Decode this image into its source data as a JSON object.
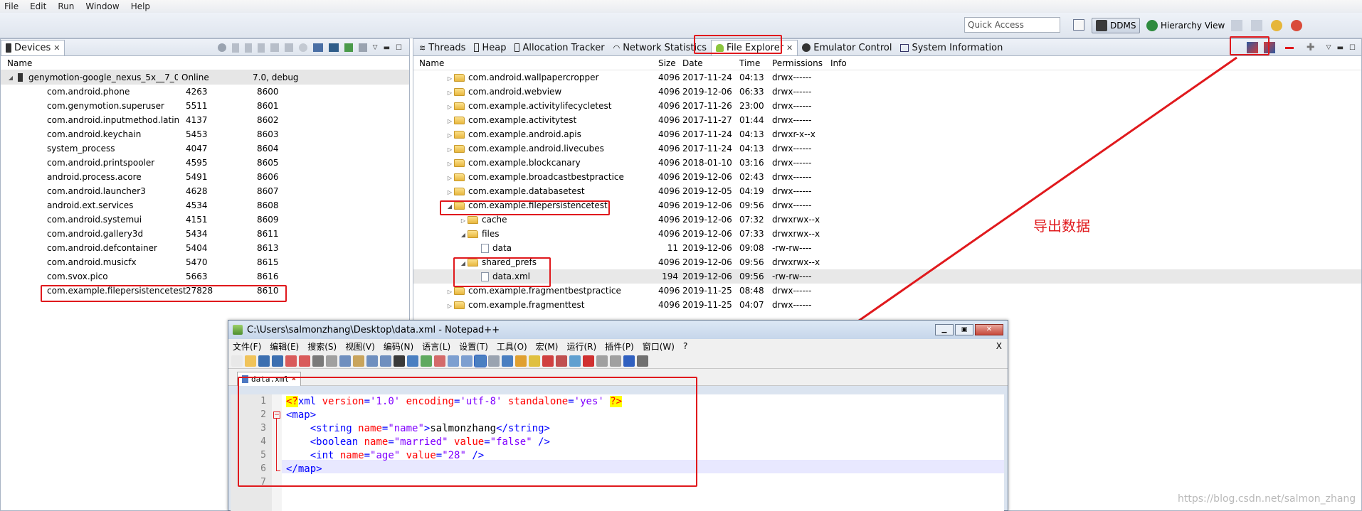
{
  "menubar": [
    "File",
    "Edit",
    "Run",
    "Window",
    "Help"
  ],
  "toolbar": {
    "quick_access_placeholder": "Quick Access",
    "ddms_label": "DDMS",
    "hierarchy_label": "Hierarchy View"
  },
  "devices": {
    "tab_label": "Devices",
    "name_header": "Name",
    "device": {
      "name": "genymotion-google_nexus_5x__7_0...",
      "state": "Online",
      "version": "7.0, debug"
    },
    "processes": [
      {
        "name": "com.android.phone",
        "pid": "4263",
        "port": "8600"
      },
      {
        "name": "com.genymotion.superuser",
        "pid": "5511",
        "port": "8601"
      },
      {
        "name": "com.android.inputmethod.latin",
        "pid": "4137",
        "port": "8602"
      },
      {
        "name": "com.android.keychain",
        "pid": "5453",
        "port": "8603"
      },
      {
        "name": "system_process",
        "pid": "4047",
        "port": "8604"
      },
      {
        "name": "com.android.printspooler",
        "pid": "4595",
        "port": "8605"
      },
      {
        "name": "android.process.acore",
        "pid": "5491",
        "port": "8606"
      },
      {
        "name": "com.android.launcher3",
        "pid": "4628",
        "port": "8607"
      },
      {
        "name": "android.ext.services",
        "pid": "4534",
        "port": "8608"
      },
      {
        "name": "com.android.systemui",
        "pid": "4151",
        "port": "8609"
      },
      {
        "name": "com.android.gallery3d",
        "pid": "5434",
        "port": "8611"
      },
      {
        "name": "com.android.defcontainer",
        "pid": "5404",
        "port": "8613"
      },
      {
        "name": "com.android.musicfx",
        "pid": "5470",
        "port": "8615"
      },
      {
        "name": "com.svox.pico",
        "pid": "5663",
        "port": "8616"
      },
      {
        "name": "com.example.filepersistencetest",
        "pid": "27828",
        "port": "8610"
      }
    ]
  },
  "right_tabs": [
    "Threads",
    "Heap",
    "Allocation Tracker",
    "Network Statistics",
    "File Explorer",
    "Emulator Control",
    "System Information"
  ],
  "file_explorer": {
    "headers": [
      "Name",
      "Size",
      "Date",
      "Time",
      "Permissions",
      "Info"
    ],
    "rows": [
      {
        "name": "com.android.wallpapercropper",
        "size": "4096",
        "date": "2017-11-24",
        "time": "04:13",
        "perm": "drwx------"
      },
      {
        "name": "com.android.webview",
        "size": "4096",
        "date": "2019-12-06",
        "time": "06:33",
        "perm": "drwx------"
      },
      {
        "name": "com.example.activitylifecycletest",
        "size": "4096",
        "date": "2017-11-26",
        "time": "23:00",
        "perm": "drwx------"
      },
      {
        "name": "com.example.activitytest",
        "size": "4096",
        "date": "2017-11-27",
        "time": "01:44",
        "perm": "drwx------"
      },
      {
        "name": "com.example.android.apis",
        "size": "4096",
        "date": "2017-11-24",
        "time": "04:13",
        "perm": "drwxr-x--x"
      },
      {
        "name": "com.example.android.livecubes",
        "size": "4096",
        "date": "2017-11-24",
        "time": "04:13",
        "perm": "drwx------"
      },
      {
        "name": "com.example.blockcanary",
        "size": "4096",
        "date": "2018-01-10",
        "time": "03:16",
        "perm": "drwx------"
      },
      {
        "name": "com.example.broadcastbestpractice",
        "size": "4096",
        "date": "2019-12-06",
        "time": "02:43",
        "perm": "drwx------"
      },
      {
        "name": "com.example.databasetest",
        "size": "4096",
        "date": "2019-12-05",
        "time": "04:19",
        "perm": "drwx------"
      },
      {
        "name": "com.example.filepersistencetest",
        "size": "4096",
        "date": "2019-12-06",
        "time": "09:56",
        "perm": "drwx------"
      },
      {
        "name": "cache",
        "size": "4096",
        "date": "2019-12-06",
        "time": "07:32",
        "perm": "drwxrwx--x"
      },
      {
        "name": "files",
        "size": "4096",
        "date": "2019-12-06",
        "time": "07:33",
        "perm": "drwxrwx--x"
      },
      {
        "name": "data",
        "size": "11",
        "date": "2019-12-06",
        "time": "09:08",
        "perm": "-rw-rw----"
      },
      {
        "name": "shared_prefs",
        "size": "4096",
        "date": "2019-12-06",
        "time": "09:56",
        "perm": "drwxrwx--x"
      },
      {
        "name": "data.xml",
        "size": "194",
        "date": "2019-12-06",
        "time": "09:56",
        "perm": "-rw-rw----"
      },
      {
        "name": "com.example.fragmentbestpractice",
        "size": "4096",
        "date": "2019-11-25",
        "time": "08:48",
        "perm": "drwx------"
      },
      {
        "name": "com.example.fragmenttest",
        "size": "4096",
        "date": "2019-11-25",
        "time": "04:07",
        "perm": "drwx------"
      }
    ]
  },
  "annotation": "导出数据",
  "notepad": {
    "title": "C:\\Users\\salmonzhang\\Desktop\\data.xml - Notepad++",
    "menu": [
      "文件(F)",
      "编辑(E)",
      "搜索(S)",
      "视图(V)",
      "编码(N)",
      "语言(L)",
      "设置(T)",
      "工具(O)",
      "宏(M)",
      "运行(R)",
      "插件(P)",
      "窗口(W)",
      "?"
    ],
    "close_x": "X",
    "tab": "data.xml",
    "line_numbers": [
      "1",
      "2",
      "3",
      "4",
      "5",
      "6",
      "7"
    ],
    "code": {
      "l1_open": "<?",
      "l1_xml": "xml",
      "l1_a1": " version",
      "l1_v1": "'1.0'",
      "l1_a2": " encoding",
      "l1_v2": "'utf-8'",
      "l1_a3": " standalone",
      "l1_v3": "'yes'",
      "l1_close": "?>",
      "l2": "<map>",
      "l3_open": "<string",
      "l3_attr": " name",
      "l3_val": "\"name\"",
      "l3_gt": ">",
      "l3_text": "salmonzhang",
      "l3_close": "</string>",
      "l4_open": "<boolean",
      "l4_a1": " name",
      "l4_v1": "\"married\"",
      "l4_a2": " value",
      "l4_v2": "\"false\"",
      "l4_close": " />",
      "l5_open": "<int",
      "l5_a1": " name",
      "l5_v1": "\"age\"",
      "l5_a2": " value",
      "l5_v2": "\"28\"",
      "l5_close": " />",
      "l6": "</map>"
    }
  },
  "watermark": "https://blog.csdn.net/salmon_zhang",
  "colors": {
    "highlight_red": "#e0191d",
    "tag_blue": "#0000ff",
    "attr_red": "#ff0000",
    "value_purple": "#8000ff"
  }
}
